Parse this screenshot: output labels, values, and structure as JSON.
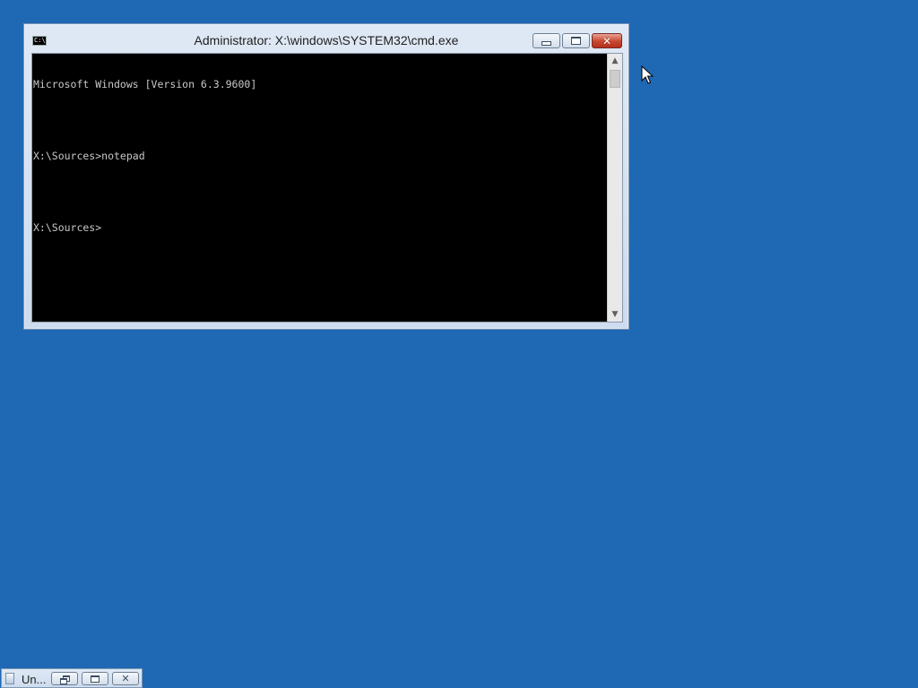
{
  "desktop": {
    "background_color": "#1f68b3"
  },
  "cmd_window": {
    "title": "Administrator: X:\\windows\\SYSTEM32\\cmd.exe",
    "icon": "console-icon",
    "icon_text": "C:\\.",
    "buttons": {
      "minimize_icon": "minimize-icon",
      "maximize_icon": "maximize-icon",
      "close_icon": "close-icon",
      "close_glyph": "✕"
    },
    "console": {
      "lines": [
        "Microsoft Windows [Version 6.3.9600]",
        "",
        "X:\\Sources>notepad",
        "",
        "X:\\Sources>"
      ],
      "text_color": "#c8c8c8",
      "background_color": "#000000"
    }
  },
  "minimized_window": {
    "title": "Un...",
    "icon": "notepad-icon",
    "buttons": {
      "restore_icon": "restore-icon",
      "maximize_icon": "maximize-icon",
      "close_icon": "close-icon",
      "close_glyph": "✕"
    }
  },
  "cursor": {
    "icon": "arrow-cursor-icon"
  }
}
